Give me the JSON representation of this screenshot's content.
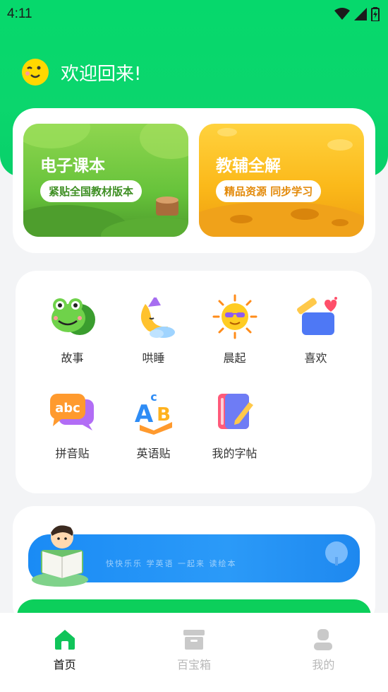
{
  "status_bar": {
    "time": "4:11"
  },
  "welcome": {
    "text": "欢迎回来!"
  },
  "book_cards": [
    {
      "title": "电子课本",
      "subtitle": "紧贴全国教材版本"
    },
    {
      "title": "教辅全解",
      "subtitle": "精品资源 同步学习"
    }
  ],
  "grid": [
    {
      "label": "故事",
      "icon": "frog-icon"
    },
    {
      "label": "哄睡",
      "icon": "moon-icon"
    },
    {
      "label": "晨起",
      "icon": "sun-icon"
    },
    {
      "label": "喜欢",
      "icon": "favorite-box-icon"
    },
    {
      "label": "拼音贴",
      "icon": "abc-bubble-icon"
    },
    {
      "label": "英语贴",
      "icon": "ab-book-icon"
    },
    {
      "label": "我的字帖",
      "icon": "copybook-icon"
    }
  ],
  "banner": {
    "text": "快快乐乐 学英语 一起来 读绘本"
  },
  "bottom_nav": [
    {
      "label": "首页",
      "icon": "home-icon",
      "active": true
    },
    {
      "label": "百宝箱",
      "icon": "box-icon",
      "active": false
    },
    {
      "label": "我的",
      "icon": "user-icon",
      "active": false
    }
  ],
  "colors": {
    "brand_green": "#06d86c",
    "nav_active": "#10c45a",
    "nav_inactive": "#c9c9c9"
  }
}
